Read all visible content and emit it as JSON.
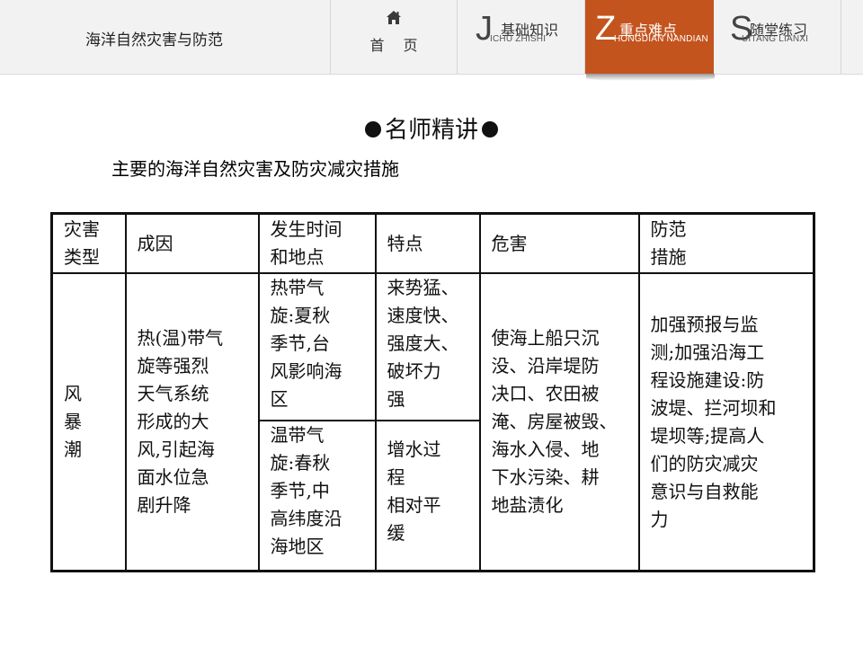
{
  "nav": {
    "lesson_title": "海洋自然灾害与防范",
    "home_label": "首 页",
    "home_icon": "home-icon",
    "tabs": [
      {
        "letter": "J",
        "label": "基础知识",
        "pinyin": "ICHU ZHISHI",
        "active": false
      },
      {
        "letter": "Z",
        "label": "重点难点",
        "pinyin": "HONGDIAN NANDIAN",
        "active": true
      },
      {
        "letter": "S",
        "label": "随堂练习",
        "pinyin": "UITANG LIANXI",
        "active": false
      }
    ],
    "active_color": "#c4541e"
  },
  "section": {
    "heading": "名师精讲",
    "subheading": "主要的海洋自然灾害及防灾减灾措施"
  },
  "table": {
    "headers": {
      "type": [
        "灾害",
        "类型"
      ],
      "cause": "成因",
      "time_place": [
        "发生时间",
        "和地点"
      ],
      "features": "特点",
      "harm": "危害",
      "measures": [
        "防范",
        "措施"
      ]
    },
    "row": {
      "type": [
        "风",
        "暴",
        "潮"
      ],
      "cause": [
        "热(温)带气",
        "旋等强烈",
        "天气系统",
        "形成的大",
        "风,引起海",
        "面水位急",
        "剧升降"
      ],
      "sub1": {
        "time_place": [
          "热带气",
          "旋:夏秋",
          "季节,台",
          "风影响海",
          "区"
        ],
        "features": [
          "来势猛、",
          "速度快、",
          "强度大、",
          "破坏力",
          "强"
        ]
      },
      "sub2": {
        "time_place": [
          "温带气",
          "旋:春秋",
          "季节,中",
          "高纬度沿",
          "海地区"
        ],
        "features": [
          "增水过",
          "程",
          "相对平",
          "缓"
        ]
      },
      "harm": [
        "使海上船只沉",
        "没、沿岸堤防",
        "决口、农田被",
        "淹、房屋被毁、",
        "海水入侵、地",
        "下水污染、耕",
        "地盐渍化"
      ],
      "measures": [
        "加强预报与监",
        "测;加强沿海工",
        "程设施建设:防",
        "波堤、拦河坝和",
        "堤坝等;提高人",
        "们的防灾减灾",
        "意识与自救能",
        "力"
      ]
    }
  }
}
